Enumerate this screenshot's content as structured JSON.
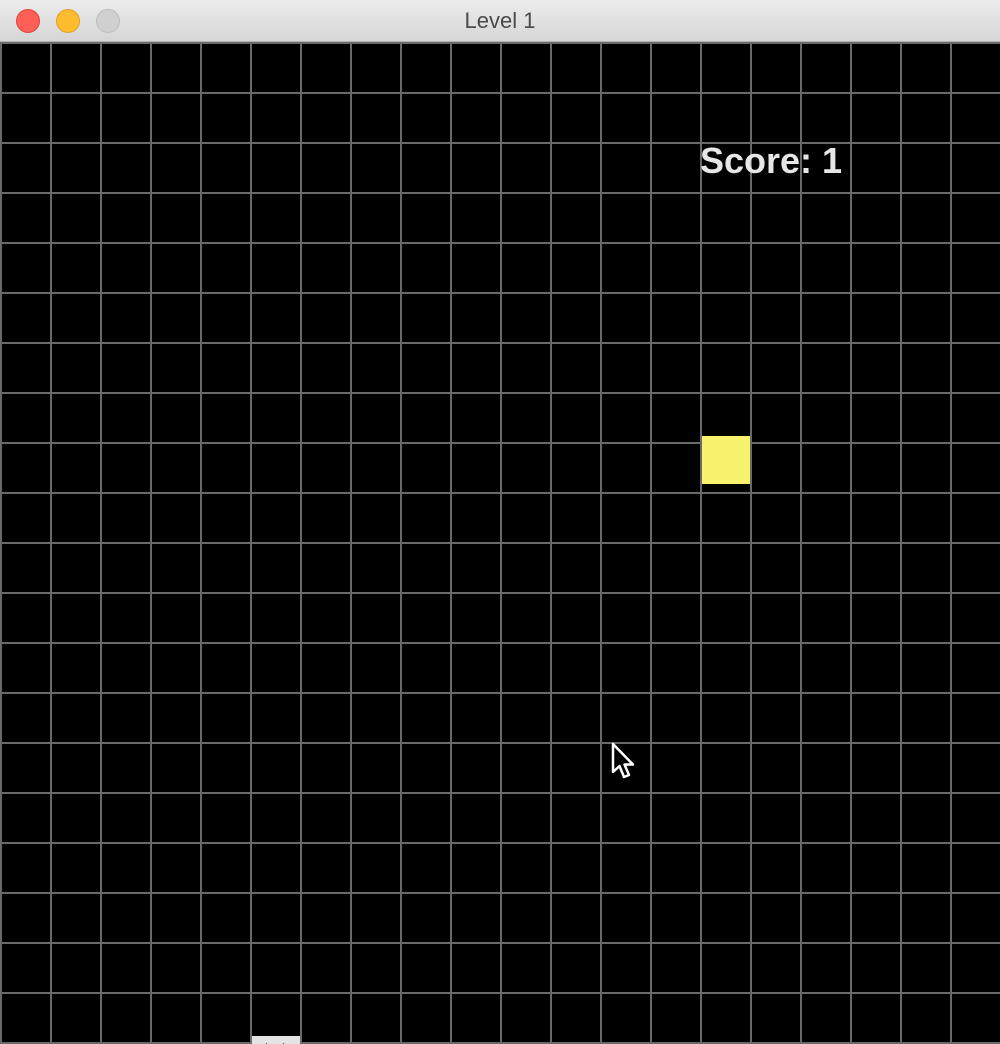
{
  "window": {
    "title": "Level 1"
  },
  "game": {
    "score_text": "Score: 1",
    "grid": {
      "columns": 20,
      "rows": 20
    },
    "food": {
      "color": "#f8f36c"
    },
    "snake": {
      "length": 1,
      "color": "#e4e4e4"
    }
  },
  "colors": {
    "background": "#000000",
    "grid_line": "#6a6a6a",
    "score_text": "#e6e6e6"
  },
  "icons": {
    "close": "close-icon",
    "minimize": "minimize-icon",
    "zoom": "zoom-icon",
    "cursor": "mouse-cursor-icon"
  }
}
